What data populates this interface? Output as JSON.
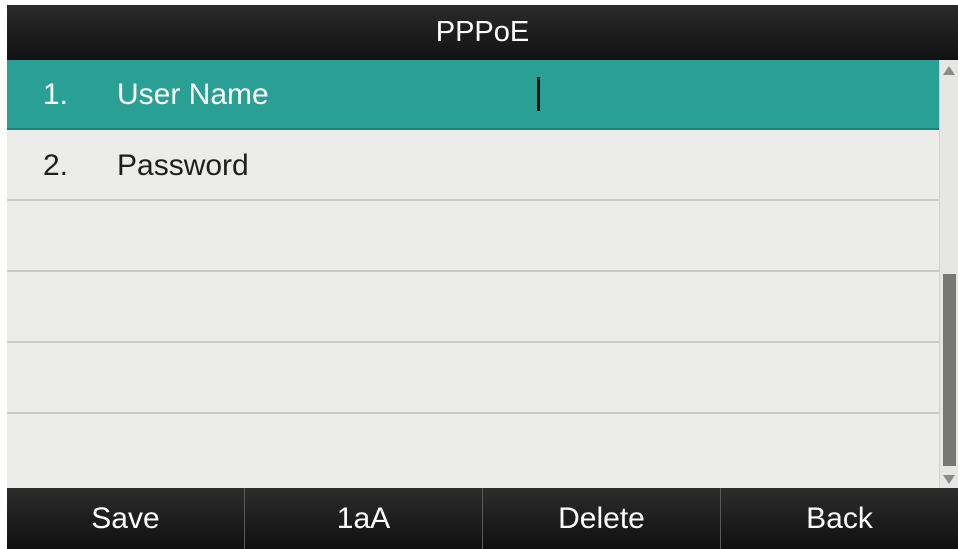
{
  "title": "PPPoE",
  "items": [
    {
      "num": "1.",
      "label": "User Name",
      "value": ""
    },
    {
      "num": "2.",
      "label": "Password",
      "value": ""
    },
    {
      "num": "",
      "label": "",
      "value": ""
    },
    {
      "num": "",
      "label": "",
      "value": ""
    },
    {
      "num": "",
      "label": "",
      "value": ""
    },
    {
      "num": "",
      "label": "",
      "value": ""
    }
  ],
  "selected_index": 0,
  "softkeys": {
    "key1": "Save",
    "key2": "1aA",
    "key3": "Delete",
    "key4": "Back"
  },
  "colors": {
    "selected_row": "#2aa095",
    "background": "#ececea",
    "bar": "#1a1a1a"
  },
  "scroll": {
    "position_fraction": 0.5
  }
}
